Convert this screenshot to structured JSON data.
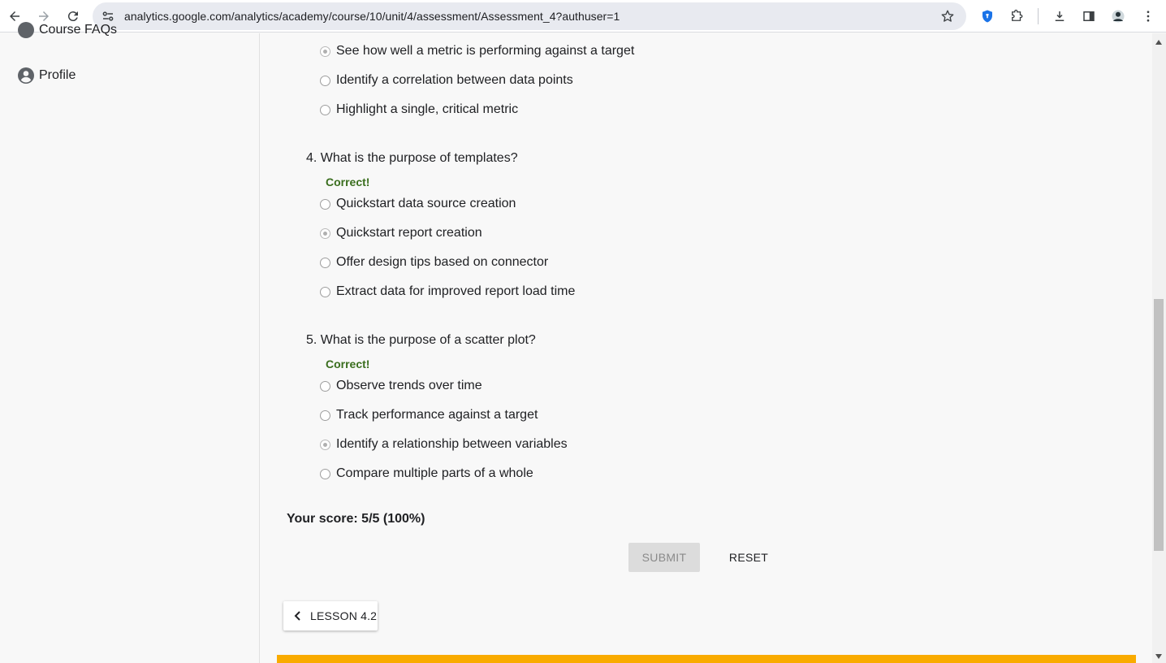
{
  "browser": {
    "url": "analytics.google.com/analytics/academy/course/10/unit/4/assessment/Assessment_4?authuser=1"
  },
  "sidebar": {
    "items": [
      {
        "label": "Course FAQs"
      },
      {
        "label": "Profile"
      }
    ]
  },
  "assessment": {
    "q3_options": [
      {
        "label": "See how well a metric is performing against a target",
        "selected": true
      },
      {
        "label": "Identify a correlation between data points",
        "selected": false
      },
      {
        "label": "Highlight a single, critical metric",
        "selected": false
      }
    ],
    "q4": {
      "question": "4. What is the purpose of templates?",
      "feedback": "Correct!",
      "options": [
        {
          "label": "Quickstart data source creation",
          "selected": false
        },
        {
          "label": "Quickstart report creation",
          "selected": true
        },
        {
          "label": "Offer design tips based on connector",
          "selected": false
        },
        {
          "label": "Extract data for improved report load time",
          "selected": false
        }
      ]
    },
    "q5": {
      "question": "5. What is the purpose of a scatter plot?",
      "feedback": "Correct!",
      "options": [
        {
          "label": "Observe trends over time",
          "selected": false
        },
        {
          "label": "Track performance against a target",
          "selected": false
        },
        {
          "label": "Identify a relationship between variables",
          "selected": true
        },
        {
          "label": "Compare multiple parts of a whole",
          "selected": false
        }
      ]
    },
    "score": "Your score: 5/5 (100%)",
    "submit_label": "SUBMIT",
    "reset_label": "RESET",
    "prev_lesson_label": "LESSON 4.2"
  },
  "colors": {
    "correct": "#3a6e1e",
    "banner": "#f9ab00"
  }
}
